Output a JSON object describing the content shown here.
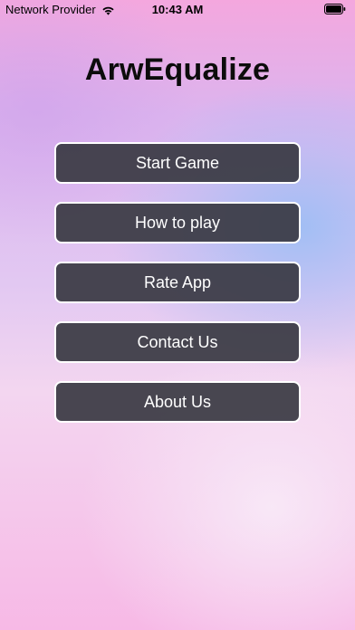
{
  "status_bar": {
    "carrier": "Network Provider",
    "time": "10:43 AM",
    "wifi_icon": "wifi-icon",
    "battery_icon": "battery-icon"
  },
  "app": {
    "title": "ArwEqualize"
  },
  "menu": {
    "start_game": "Start Game",
    "how_to_play": "How to play",
    "rate_app": "Rate App",
    "contact_us": "Contact Us",
    "about_us": "About Us"
  },
  "colors": {
    "button_bg": "#3a3a44",
    "button_border": "#ffffff",
    "button_text": "#ffffff",
    "title_text": "#0c0c0c"
  }
}
